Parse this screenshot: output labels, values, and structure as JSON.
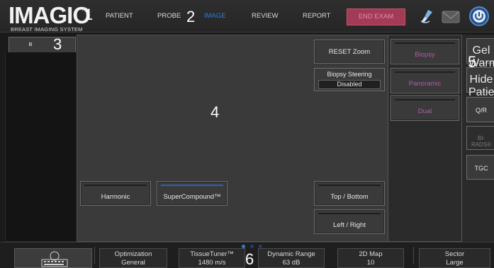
{
  "header": {
    "logo": "IMAGIO",
    "logo_tm": "TM",
    "logo_subtitle": "BREAST IMAGING SYSTEM",
    "nav": [
      "PATIENT",
      "PROBE",
      "IMAGE",
      "REVIEW",
      "REPORT"
    ],
    "active_nav": "IMAGE",
    "end_exam": "END EXAM",
    "icons": [
      "probe-icon",
      "mail-icon",
      "power-icon"
    ]
  },
  "markers": [
    "1",
    "2",
    "3",
    "4",
    "5",
    "6"
  ],
  "tab": {
    "label": "B"
  },
  "image_panel": {
    "reset_zoom": "RESET Zoom",
    "biopsy_steering_title": "Biopsy Steering",
    "biopsy_steering_value": "Disabled",
    "harmonic": "Harmonic",
    "supercompound": "SuperCompound™",
    "top_bottom": "Top / Bottom",
    "left_right": "Left / Right"
  },
  "right_col": {
    "biopsy": "Biopsy",
    "panoramic": "Panoramic",
    "dual": "Dual"
  },
  "edge_col": {
    "gel_warmer": "Gel Warmer",
    "hide_patient": "Hide Patient",
    "qr": "Q/R",
    "birads": "BI-RADS®",
    "tgc": "TGC"
  },
  "bottom": {
    "controls": [
      {
        "label": "Optimization",
        "value": "General"
      },
      {
        "label": "TissueTuner™",
        "value": "1480 m/s"
      },
      {
        "label": "Dynamic Range",
        "value": "63 dB"
      },
      {
        "label": "2D Map",
        "value": "10"
      },
      {
        "label": "Sector",
        "value": "Large"
      }
    ]
  },
  "colors": {
    "accent_blue": "#2f7bd6",
    "end_exam": "#a33a56",
    "pink_text": "#b25aa6"
  }
}
